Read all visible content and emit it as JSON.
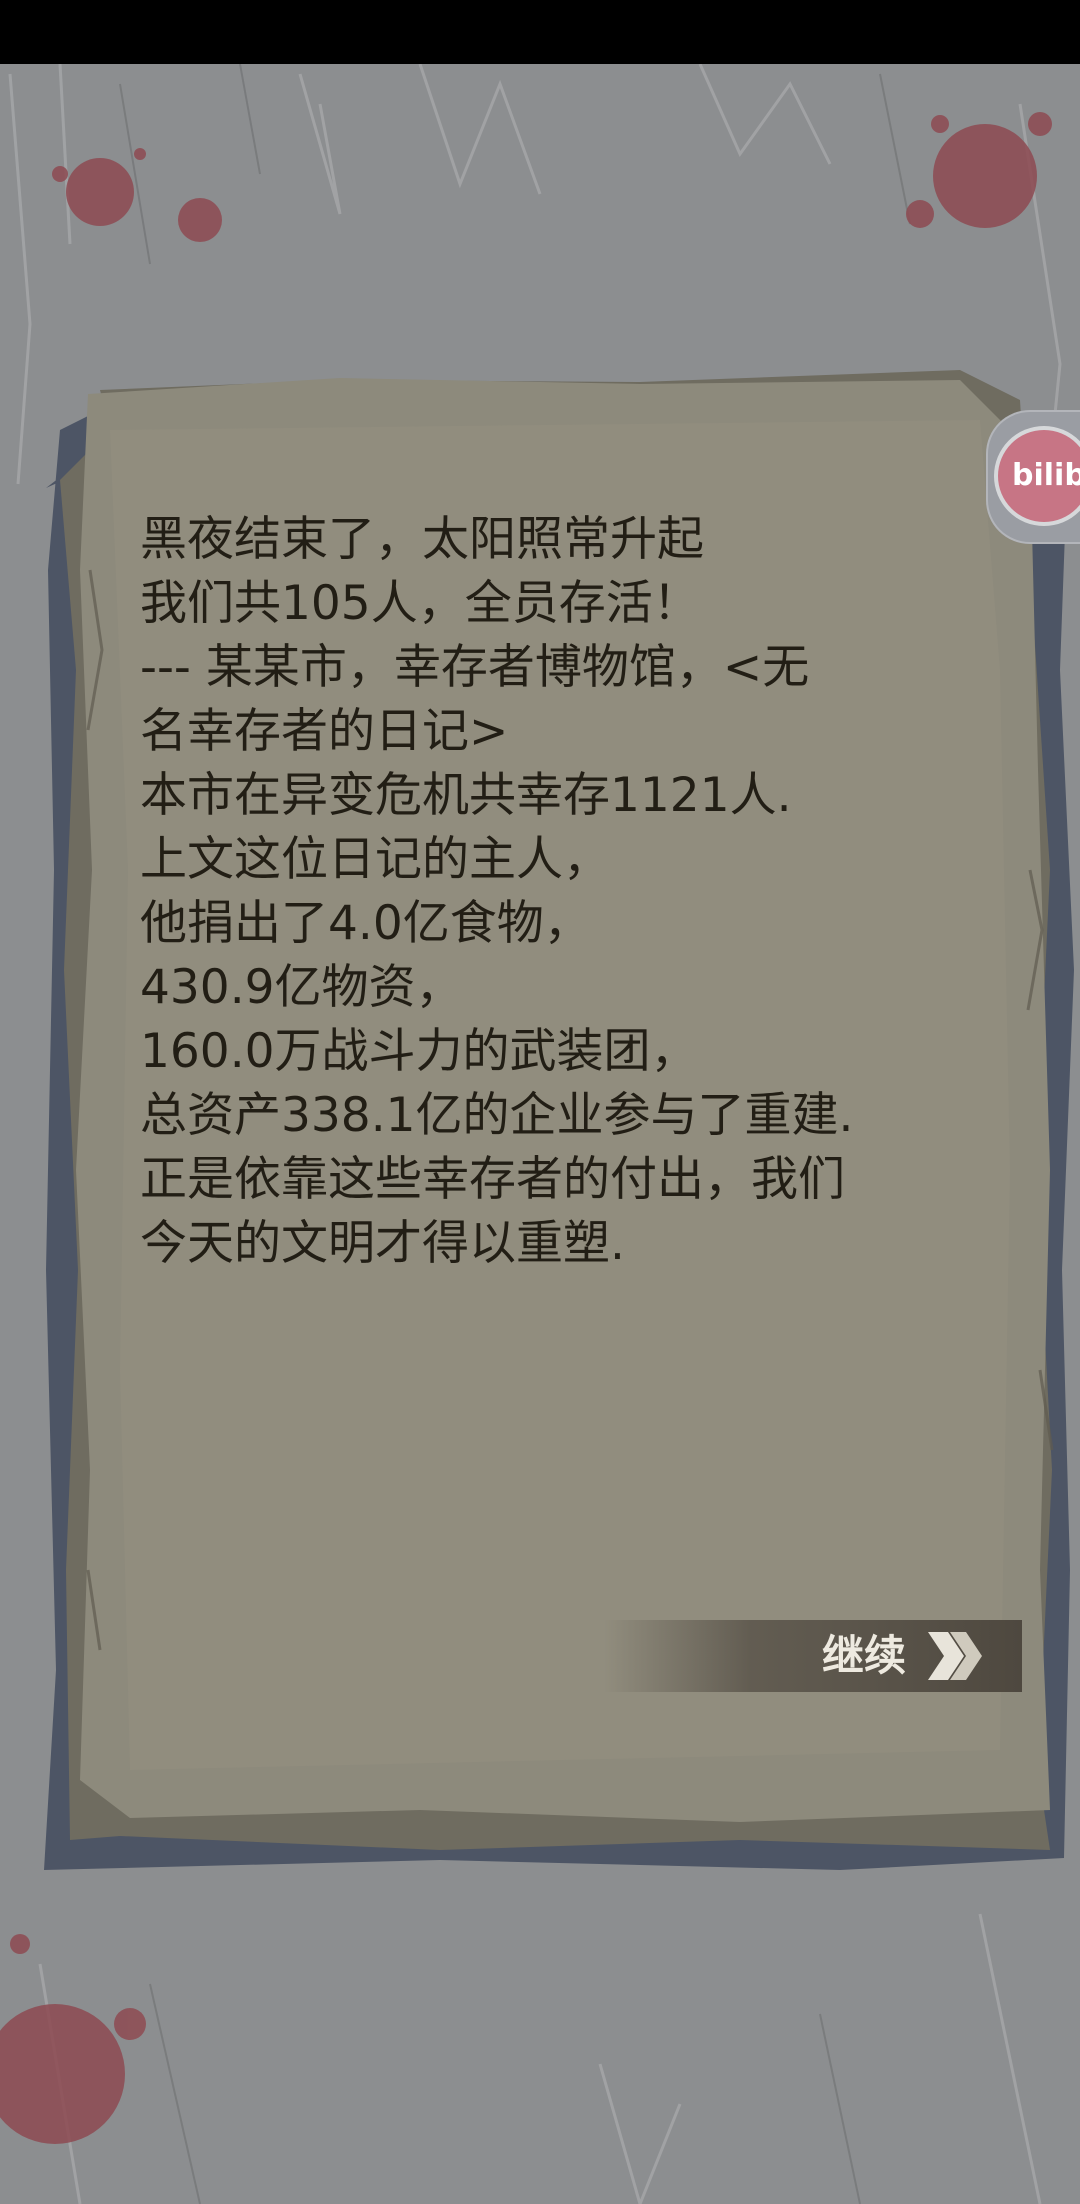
{
  "diary": {
    "lines": [
      "黑夜结束了，太阳照常升起",
      "我们共105人，全员存活！",
      "---  某某市，幸存者博物馆，<无",
      "名幸存者的日记>",
      "本市在异变危机共幸存1121人.",
      "上文这位日记的主人，",
      "他捐出了4.0亿食物，",
      "430.9亿物资，",
      "160.0万战斗力的武装团，",
      "总资产338.1亿的企业参与了重建.",
      "正是依靠这些幸存者的付出，我们",
      "今天的文明才得以重塑."
    ]
  },
  "continue_button": {
    "label": "继续",
    "icon": "double-chevron-right-icon"
  },
  "floating_badge": {
    "text": "bilib",
    "icon": "bilibili-logo-icon"
  },
  "colors": {
    "background": "#8a8c8e",
    "paper": "#8d8a7c",
    "paper_edge": "#4d5565",
    "text": "#221e15",
    "button_bg": "#5a544a",
    "blood": "#8e4b52"
  }
}
